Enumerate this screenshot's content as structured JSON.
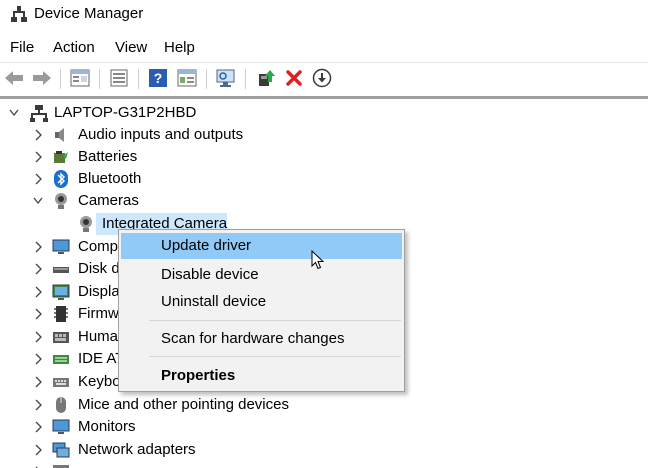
{
  "window": {
    "title": "Device Manager"
  },
  "menu": [
    "File",
    "Action",
    "View",
    "Help"
  ],
  "toolbar": [
    "back-icon",
    "forward-icon",
    "properties-view-icon",
    "list-view-icon",
    "help-icon",
    "details-view-icon",
    "scan-hardware-icon",
    "update-driver-icon",
    "uninstall-icon",
    "download-icon"
  ],
  "tree": {
    "root": "LAPTOP-G31P2HBD",
    "items": [
      {
        "label": "Audio inputs and outputs",
        "icon": "speaker-icon"
      },
      {
        "label": "Batteries",
        "icon": "battery-icon"
      },
      {
        "label": "Bluetooth",
        "icon": "bluetooth-icon"
      },
      {
        "label": "Cameras",
        "icon": "camera-icon"
      },
      {
        "label": "Integrated Camera",
        "icon": "camera-icon"
      },
      {
        "label": "Comp",
        "icon": "monitor-icon"
      },
      {
        "label": "Disk d",
        "icon": "disk-icon"
      },
      {
        "label": "Displa",
        "icon": "display-adapter-icon"
      },
      {
        "label": "Firmw",
        "icon": "chip-icon"
      },
      {
        "label": "Huma",
        "icon": "keyboard-icon"
      },
      {
        "label": "IDE AT",
        "icon": "ide-icon"
      },
      {
        "label": "Keybo",
        "icon": "keyboard-icon"
      },
      {
        "label": "Mice and other pointing devices",
        "icon": "mouse-icon"
      },
      {
        "label": "Monitors",
        "icon": "monitor-icon"
      },
      {
        "label": "Network adapters",
        "icon": "network-icon"
      }
    ]
  },
  "context_menu": {
    "items": [
      "Update driver",
      "Disable device",
      "Uninstall device",
      "Scan for hardware changes",
      "Properties"
    ],
    "highlighted": "Update driver"
  },
  "colors": {
    "selection": "#cce8ff",
    "menu_highlight": "#91c9f7",
    "uninstall_red": "#e02020"
  }
}
